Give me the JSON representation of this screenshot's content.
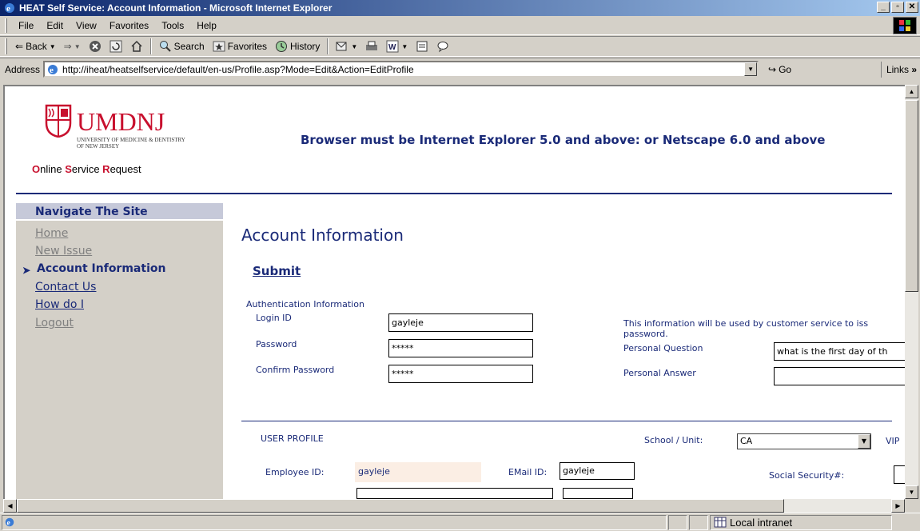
{
  "window": {
    "title": "HEAT Self Service: Account Information - Microsoft Internet Explorer"
  },
  "menu": [
    "File",
    "Edit",
    "View",
    "Favorites",
    "Tools",
    "Help"
  ],
  "toolbar": {
    "back": "Back",
    "search": "Search",
    "favorites": "Favorites",
    "history": "History"
  },
  "address": {
    "label": "Address",
    "url": "http://iheat/heatselfservice/default/en-us/Profile.asp?Mode=Edit&Action=EditProfile",
    "go": "Go",
    "links": "Links"
  },
  "header": {
    "logo_word": "UMDNJ",
    "logo_sub": "UNIVERSITY OF MEDICINE & DENTISTRY OF NEW JERSEY",
    "osr_o": "O",
    "osr_1": "nline ",
    "osr_s": "S",
    "osr_2": "ervice ",
    "osr_r": "R",
    "osr_3": "equest",
    "banner": "Browser must be Internet Explorer 5.0 and above: or Netscape 6.0 and above"
  },
  "nav": {
    "title": "Navigate The Site",
    "items": [
      {
        "label": "Home"
      },
      {
        "label": "New Issue"
      },
      {
        "label": "Account Information"
      },
      {
        "label": "Contact Us"
      },
      {
        "label": "How do I"
      },
      {
        "label": "Logout"
      }
    ]
  },
  "main": {
    "title": "Account Information",
    "submit": "Submit",
    "auth_heading": "Authentication Information",
    "login_label": "Login ID",
    "login_value": "gayleje",
    "password_label": "Password",
    "password_value": "*****",
    "confirm_label": "Confirm Password",
    "confirm_value": "*****",
    "info_line1": "This information will be used by customer service to iss",
    "info_line2": "password.",
    "question_label": "Personal Question",
    "question_value": "what is the first day of th",
    "answer_label": "Personal Answer",
    "answer_value": "",
    "profile_heading": "USER PROFILE",
    "school_label": "School / Unit:",
    "school_value": "CA",
    "vip_label": "VIP",
    "employee_label": "Employee ID:",
    "employee_value": "gayleje",
    "email_label": "EMail ID:",
    "email_value": "gayleje",
    "ssn_label": "Social Security#:"
  },
  "status": {
    "zone": "Local intranet"
  }
}
